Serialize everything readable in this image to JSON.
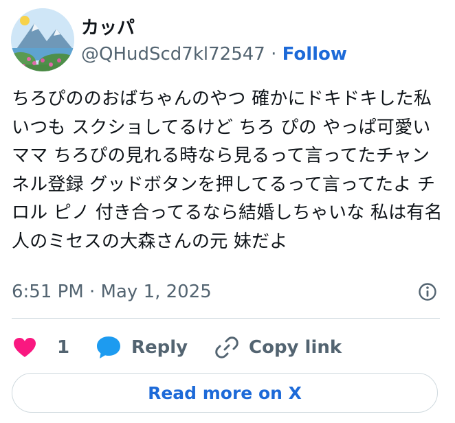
{
  "author": {
    "display_name": "カッパ",
    "handle": "@QHudScd7kl72547",
    "separator": "·",
    "follow_label": "Follow",
    "avatar_icon": "landscape-avatar"
  },
  "tweet": {
    "text": "ちろぴののおばちゃんのやつ 確かにドキドキした私 いつも スクショしてるけど ちろ ぴの やっぱ可愛いママ ちろぴの見れる時なら見るって言ってたチャンネル登録 グッドボタンを押してるって言ってたよ チロル ピノ 付き合ってるなら結婚しちゃいな 私は有名人のミセスの大森さんの元 妹だよ",
    "timestamp": "6:51 PM · May 1, 2025",
    "info_icon": "info-icon"
  },
  "actions": {
    "like_count": "1",
    "like_icon": "heart-icon",
    "like_color": "#f91880",
    "reply_label": "Reply",
    "reply_icon": "speech-bubble-icon",
    "reply_color": "#1d9bf0",
    "copy_label": "Copy link",
    "copy_icon": "link-icon"
  },
  "footer": {
    "read_more_label": "Read more on X"
  },
  "colors": {
    "accent": "#1d6ad8",
    "muted": "#536471",
    "border": "#cfd9de"
  }
}
